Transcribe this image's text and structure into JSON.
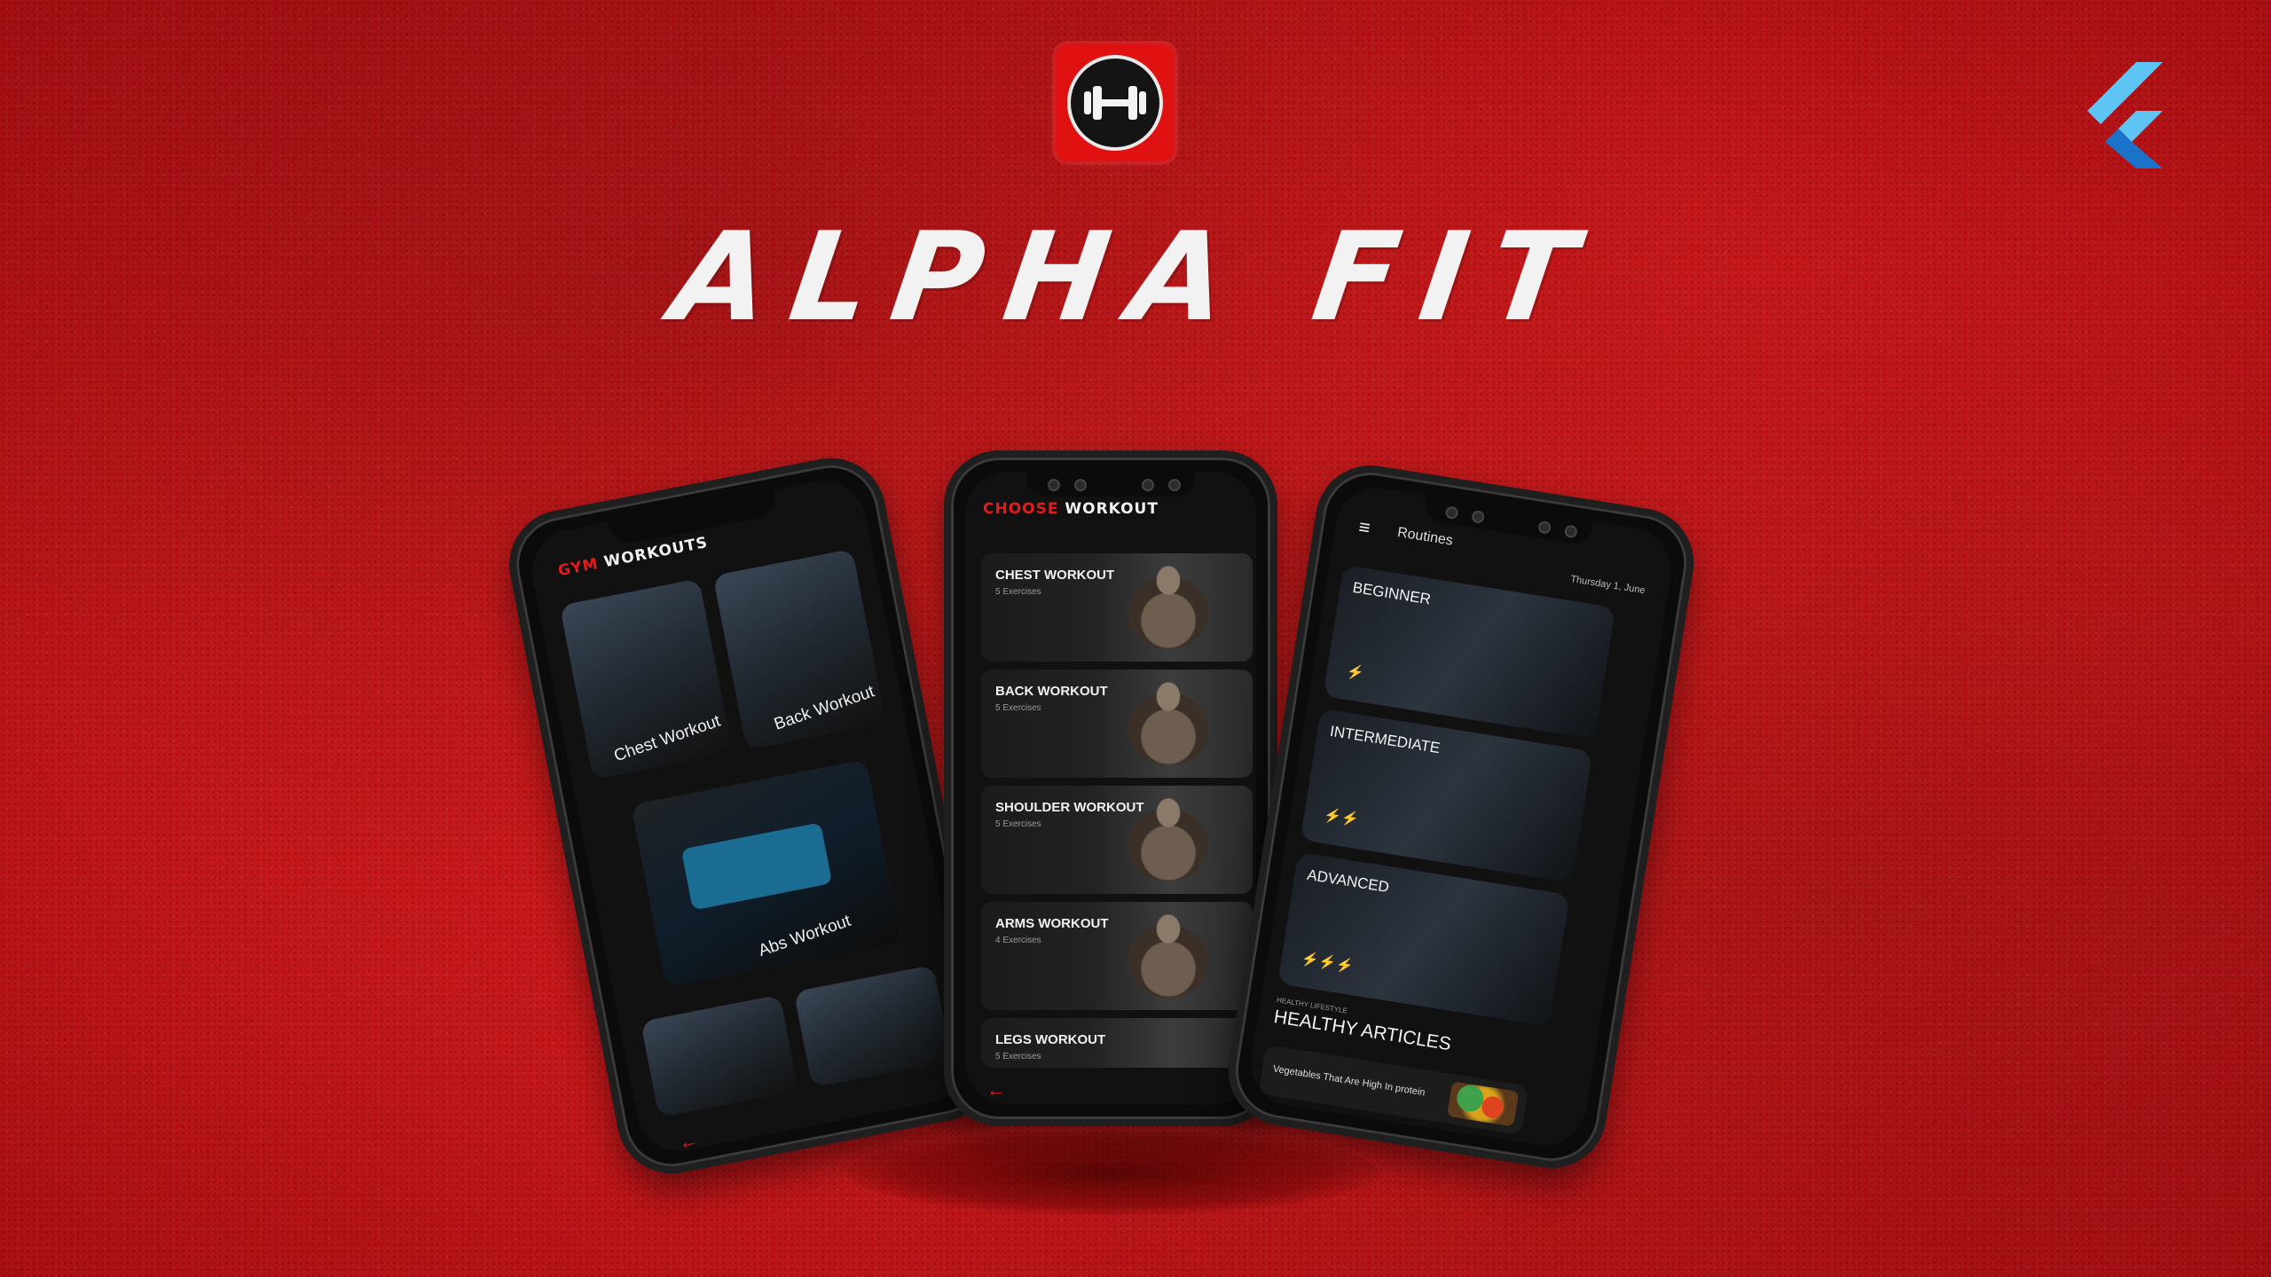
{
  "app_title": "ALPHA FIT",
  "icons": {
    "logo": "dumbbell-logo-icon",
    "framework": "flutter-logo-icon"
  },
  "colors": {
    "background": "#c8181a",
    "accent": "#e21b1b",
    "screen": "#111111"
  },
  "left_phone": {
    "header_accent": "GYM",
    "header_main": "WORKOUTS",
    "tiles": [
      {
        "label": "Chest Workout"
      },
      {
        "label": "Back Workout"
      },
      {
        "label": "Abs Workout"
      },
      {
        "label": ""
      },
      {
        "label": ""
      }
    ],
    "back_icon": "←"
  },
  "center_phone": {
    "header_accent": "CHOOSE",
    "header_main": "WORKOUT",
    "workouts": [
      {
        "title": "CHEST WORKOUT",
        "subtitle": "5 Exercises"
      },
      {
        "title": "BACK WORKOUT",
        "subtitle": "5 Exercises"
      },
      {
        "title": "SHOULDER WORKOUT",
        "subtitle": "5 Exercises"
      },
      {
        "title": "ARMS WORKOUT",
        "subtitle": "4 Exercises"
      },
      {
        "title": "LEGS WORKOUT",
        "subtitle": "5 Exercises"
      }
    ],
    "back_icon": "←"
  },
  "right_phone": {
    "menu_icon": "≡",
    "title": "Routines",
    "date": "Thursday 1, June",
    "routines": [
      {
        "label": "BEGINNER",
        "bolts": "⚡"
      },
      {
        "label": "INTERMEDIATE",
        "bolts": "⚡⚡"
      },
      {
        "label": "ADVANCED",
        "bolts": "⚡⚡⚡"
      }
    ],
    "articles_kicker": "HEALTHY LIFESTYLE",
    "articles_title": "HEALTHY ARTICLES",
    "article_item": "Vegetables That Are High In protein"
  }
}
